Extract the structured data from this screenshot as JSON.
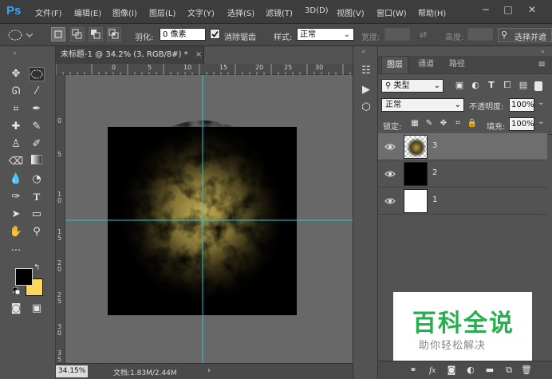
{
  "app": {
    "logo": "Ps"
  },
  "menu": [
    "文件(F)",
    "编辑(E)",
    "图像(I)",
    "图层(L)",
    "文字(Y)",
    "选择(S)",
    "滤镜(T)",
    "3D(D)",
    "视图(V)",
    "窗口(W)",
    "帮助(H)"
  ],
  "window_controls": {
    "minimize": "─",
    "maximize": "□",
    "close": "✕"
  },
  "options": {
    "feather_label": "羽化:",
    "feather_value": "0 像素",
    "antialias_label": "消除锯齿",
    "style_label": "样式:",
    "style_value": "正常",
    "width_label": "宽度:",
    "height_label": "高度:",
    "select_mask": "选择并遮"
  },
  "document": {
    "tab_title": "未标题-1 @ 34.2% (3, RGB/8#) *",
    "close": "×",
    "ruler_h": [
      "0",
      "5",
      "10",
      "15",
      "20",
      "25",
      "30"
    ],
    "ruler_v": [
      "0",
      "5",
      "1\n0",
      "1\n5",
      "2\n0",
      "2\n5",
      "3\n0",
      "3\n5"
    ],
    "zoom": "34.15%",
    "doc_info": "文档:1.83M/2.44M",
    "status_arrow": "›"
  },
  "colors": {
    "foreground": "#000000",
    "background": "#ffd75a",
    "guide": "#27c6d6",
    "accent": "#31a8ff"
  },
  "layers_panel": {
    "tabs": [
      "图层",
      "通道",
      "路径"
    ],
    "active_tab": 0,
    "kind_filter": "类型",
    "blend_mode": "正常",
    "opacity_label": "不透明度:",
    "opacity_value": "100%",
    "lock_label": "锁定:",
    "fill_label": "填充:",
    "fill_value": "100%",
    "layers": [
      {
        "name": "3",
        "selected": true,
        "thumb": "pattern"
      },
      {
        "name": "2",
        "selected": false,
        "thumb": "black"
      },
      {
        "name": "1",
        "selected": false,
        "thumb": "white"
      }
    ],
    "bottom_icons": [
      "link-icon",
      "fx-icon",
      "mask-icon",
      "adjustment-icon",
      "group-icon",
      "new-layer-icon",
      "trash-icon"
    ]
  },
  "watermark": {
    "title": "百科全说",
    "subtitle": "助你轻松解决"
  }
}
